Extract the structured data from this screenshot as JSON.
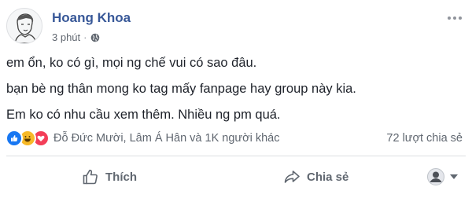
{
  "post": {
    "author": "Hoang Khoa",
    "time": "3 phút",
    "separator": "·",
    "privacy_icon": "globe-icon",
    "more_icon": "more-options-icon",
    "lines": [
      "em ổn, ko có gì, mọi ng chế vui có sao đâu.",
      "bạn bè ng thân mong ko tag mấy fanpage hay group này kia.",
      "Em ko có nhu cầu xem thêm. Nhiều ng pm quá."
    ]
  },
  "reactions": {
    "icons": [
      "like-reaction-icon",
      "haha-reaction-icon",
      "love-reaction-icon"
    ],
    "names": "Đỗ Đức Mười, Lâm Á Hân và 1K người khác",
    "shares": "72 lượt chia sẻ"
  },
  "actions": {
    "like_label": "Thích",
    "share_label": "Chia sẻ"
  },
  "colors": {
    "author": "#385898",
    "text": "#1d2129",
    "muted": "#606770",
    "like": "#1877f2",
    "haha": "#f7b928",
    "love": "#f33e58"
  }
}
